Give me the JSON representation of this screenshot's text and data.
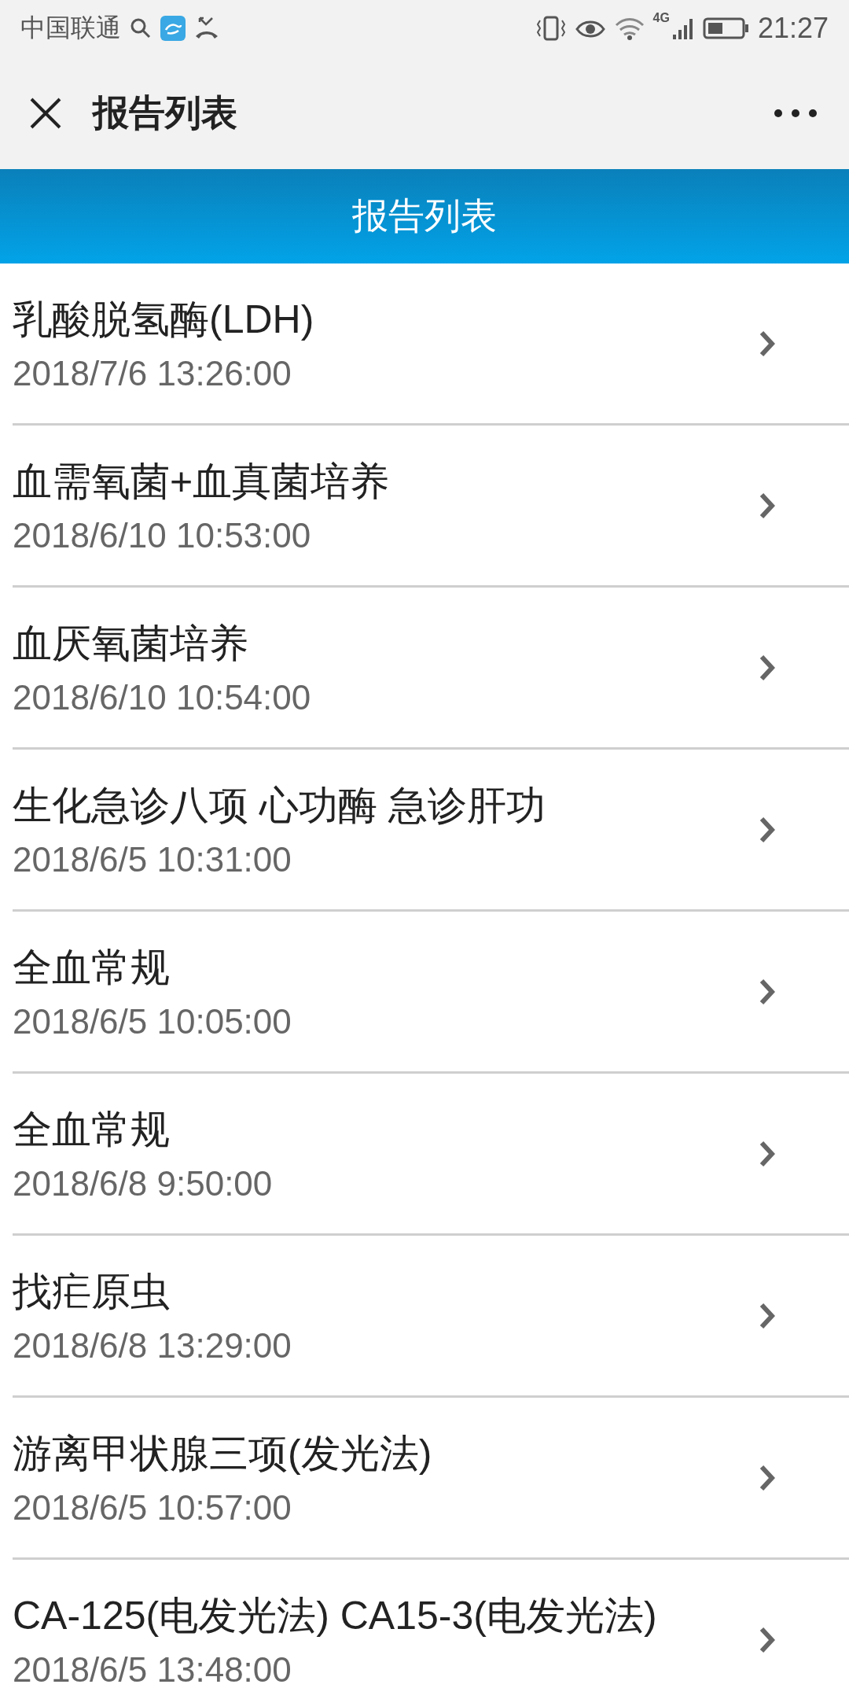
{
  "status_bar": {
    "carrier": "中国联通",
    "network_label": "4G",
    "time": "21:27"
  },
  "header": {
    "title": "报告列表"
  },
  "banner": {
    "title": "报告列表"
  },
  "reports": [
    {
      "name": "乳酸脱氢酶(LDH)",
      "time": "2018/7/6 13:26:00"
    },
    {
      "name": "血需氧菌+血真菌培养",
      "time": "2018/6/10 10:53:00"
    },
    {
      "name": "血厌氧菌培养",
      "time": "2018/6/10 10:54:00"
    },
    {
      "name": "生化急诊八项 心功酶 急诊肝功",
      "time": "2018/6/5 10:31:00"
    },
    {
      "name": "全血常规",
      "time": "2018/6/5 10:05:00"
    },
    {
      "name": "全血常规",
      "time": "2018/6/8 9:50:00"
    },
    {
      "name": "找疟原虫",
      "time": "2018/6/8 13:29:00"
    },
    {
      "name": "游离甲状腺三项(发光法)",
      "time": "2018/6/5 10:57:00"
    },
    {
      "name": "CA-125(电发光法) CA15-3(电发光法)",
      "time": "2018/6/5 13:48:00"
    }
  ]
}
